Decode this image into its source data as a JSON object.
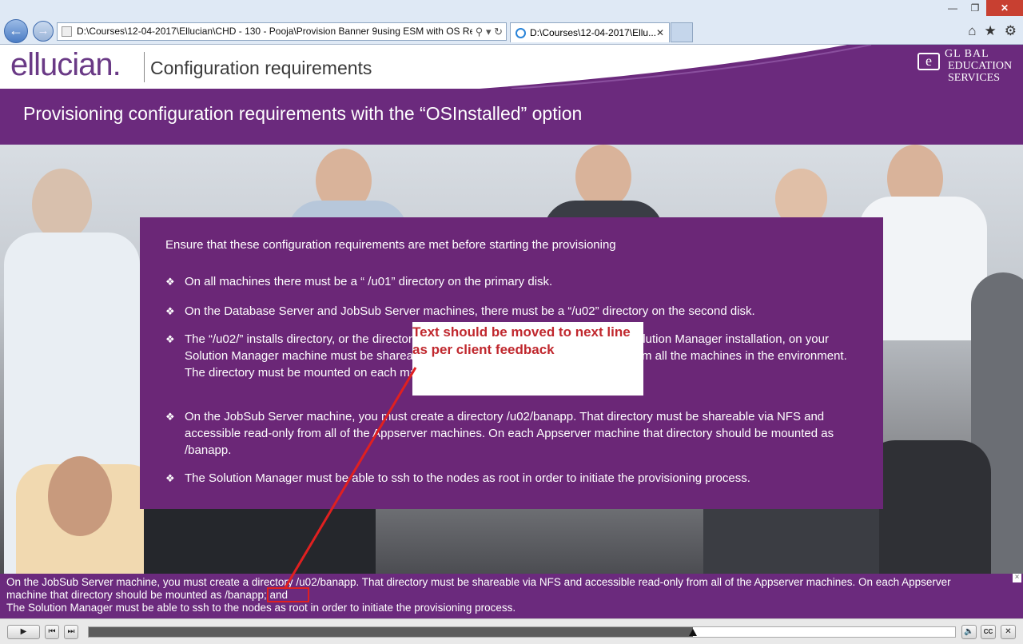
{
  "browser": {
    "address": "D:\\Courses\\12-04-2017\\Ellucian\\CHD - 130 - Pooja\\Provision Banner 9using ESM with OS Re",
    "tab_title": "D:\\Courses\\12-04-2017\\Ellu...",
    "tab_close": "✕"
  },
  "header": {
    "logo": "ellucian.",
    "course_title": "Configuration requirements",
    "brand_badge": "e",
    "brand_line1": "GL BAL",
    "brand_line2": "EDUCATION",
    "brand_line3": "SERVICES"
  },
  "slide": {
    "title": "Provisioning configuration requirements with the “OSInstalled” option",
    "intro": "Ensure that these configuration requirements are met before starting the provisioning",
    "bullets": [
      "On all machines there must be a “ /u01” directory on the primary disk.",
      "On the Database Server and JobSub Server machines, there must be a “/u02” directory on the second disk.",
      "The “/u02/” installs directory, or the directory containing the installs directory in your Solution Manager installation, on your Solution Manager machine must be shareable using NFS and accessible read-only from all the machines in the environment. The directory must be mounted on each machine in the environment as /cdcache.",
      "On the JobSub Server machine, you must create a directory /u02/banapp. That directory must be shareable via NFS and accessible read-only from all of the Appserver machines. On each Appserver machine that directory should be mounted as /banapp.",
      "The Solution Manager must be able to ssh to the nodes as root in order to initiate the provisioning process."
    ],
    "bullet_mark": "❖"
  },
  "annotation": {
    "note": "Text should be moved to next line as per client feedback"
  },
  "captions": {
    "line1": "On the JobSub Server machine, you must create a directory /u02/banapp. That directory must be shareable via NFS and accessible read-only from all of the Appserver machines. On each Appserver",
    "line2": "machine that directory should be mounted as /banapp; and",
    "line3": "The Solution Manager must be able to ssh to the nodes as root in order to initiate the provisioning process.",
    "close": "×"
  },
  "player": {
    "progress": 0.697,
    "cc_label": "CC"
  }
}
